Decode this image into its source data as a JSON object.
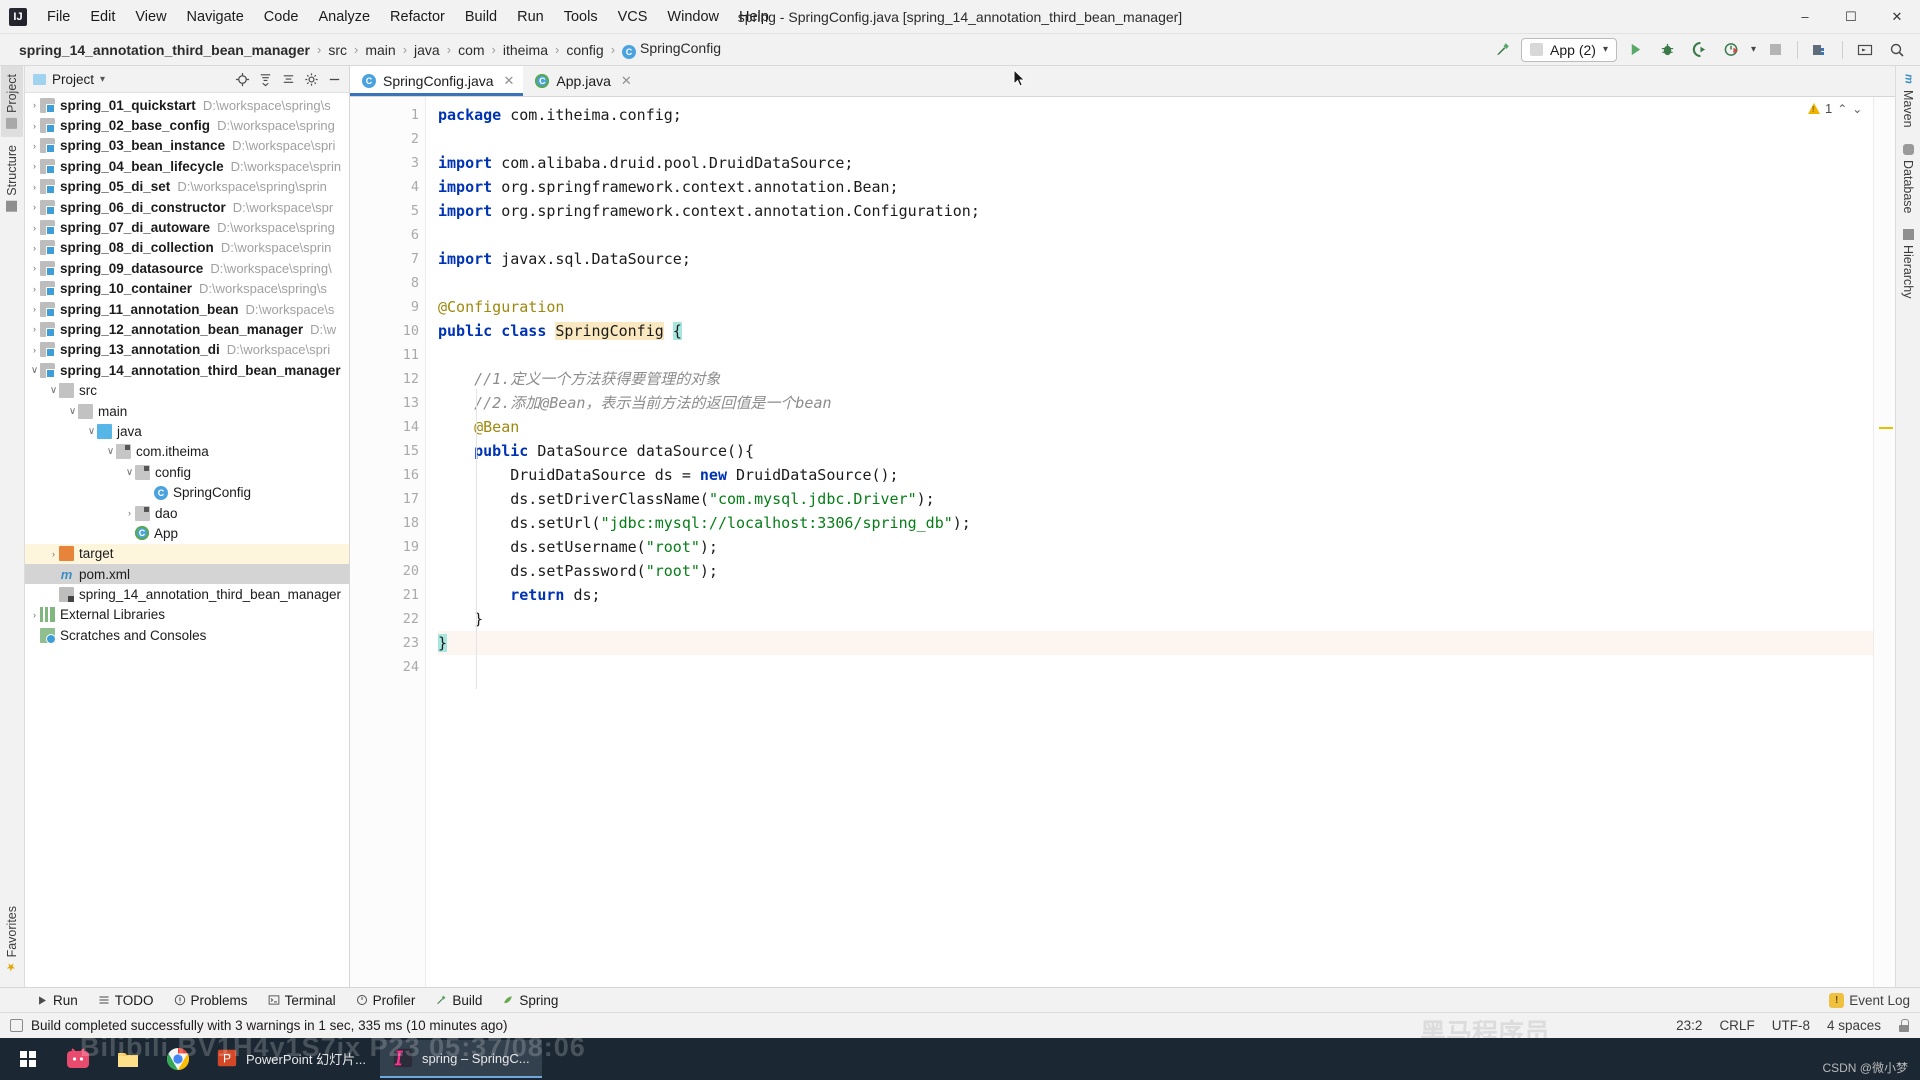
{
  "window": {
    "title": "spring - SpringConfig.java [spring_14_annotation_third_bean_manager]",
    "logo": "intellij-idea-logo",
    "minimize": "–",
    "maximize": "☐",
    "close": "✕"
  },
  "menu": [
    {
      "label": "File"
    },
    {
      "label": "Edit"
    },
    {
      "label": "View"
    },
    {
      "label": "Navigate"
    },
    {
      "label": "Code"
    },
    {
      "label": "Analyze"
    },
    {
      "label": "Refactor"
    },
    {
      "label": "Build"
    },
    {
      "label": "Run"
    },
    {
      "label": "Tools"
    },
    {
      "label": "VCS"
    },
    {
      "label": "Window"
    },
    {
      "label": "Help"
    }
  ],
  "breadcrumb": {
    "root": "spring_14_annotation_third_bean_manager",
    "items": [
      "src",
      "main",
      "java",
      "com",
      "itheima",
      "config"
    ],
    "leaf": "SpringConfig",
    "leaf_icon_letter": "C",
    "separator": "›"
  },
  "toolbar": {
    "build_icon": "hammer-icon",
    "run_config": "App (2)",
    "run_config_caret": "▾",
    "run_icon": "run-play-icon",
    "debug_icon": "debug-bug-icon",
    "run_coverage_icon": "run-with-coverage-icon",
    "profiler_icon": "profiler-icon",
    "profiler_caret": "▾",
    "stop_icon": "stop-icon",
    "updates_icon": "project-structure-icon",
    "layout_icon": "layout-icon",
    "search_icon": "search-everywhere-icon"
  },
  "left_strip": {
    "top": [
      {
        "label": "Project",
        "icon": "project-icon",
        "active": true
      },
      {
        "label": "Structure",
        "icon": "structure-icon",
        "active": false
      }
    ],
    "bottom": [
      {
        "label": "Favorites",
        "icon": "star-icon"
      }
    ]
  },
  "right_strip": {
    "items": [
      {
        "label": "Maven",
        "icon": "maven-icon"
      },
      {
        "label": "Database",
        "icon": "database-icon"
      },
      {
        "label": "Hierarchy",
        "icon": "hierarchy-icon"
      }
    ]
  },
  "project_panel": {
    "title": "Project",
    "title_caret": "▾",
    "actions": [
      {
        "name": "locate-icon",
        "glyph": "⊕"
      },
      {
        "name": "expand-all-icon",
        "glyph": "≣"
      },
      {
        "name": "collapse-all-icon",
        "glyph": "≡"
      },
      {
        "name": "settings-gear-icon",
        "glyph": "⚙"
      },
      {
        "name": "hide-icon",
        "glyph": "—"
      }
    ],
    "tree": [
      {
        "depth": 1,
        "arrow": "›",
        "icon": "module",
        "name": "spring_01_quickstart",
        "bold": true,
        "path": "D:\\workspace\\spring\\s"
      },
      {
        "depth": 1,
        "arrow": "›",
        "icon": "module",
        "name": "spring_02_base_config",
        "bold": true,
        "path": "D:\\workspace\\spring"
      },
      {
        "depth": 1,
        "arrow": "›",
        "icon": "module",
        "name": "spring_03_bean_instance",
        "bold": true,
        "path": "D:\\workspace\\spri"
      },
      {
        "depth": 1,
        "arrow": "›",
        "icon": "module",
        "name": "spring_04_bean_lifecycle",
        "bold": true,
        "path": "D:\\workspace\\sprin"
      },
      {
        "depth": 1,
        "arrow": "›",
        "icon": "module",
        "name": "spring_05_di_set",
        "bold": true,
        "path": "D:\\workspace\\spring\\sprin"
      },
      {
        "depth": 1,
        "arrow": "›",
        "icon": "module",
        "name": "spring_06_di_constructor",
        "bold": true,
        "path": "D:\\workspace\\spr"
      },
      {
        "depth": 1,
        "arrow": "›",
        "icon": "module",
        "name": "spring_07_di_autoware",
        "bold": true,
        "path": "D:\\workspace\\spring"
      },
      {
        "depth": 1,
        "arrow": "›",
        "icon": "module",
        "name": "spring_08_di_collection",
        "bold": true,
        "path": "D:\\workspace\\sprin"
      },
      {
        "depth": 1,
        "arrow": "›",
        "icon": "module",
        "name": "spring_09_datasource",
        "bold": true,
        "path": "D:\\workspace\\spring\\"
      },
      {
        "depth": 1,
        "arrow": "›",
        "icon": "module",
        "name": "spring_10_container",
        "bold": true,
        "path": "D:\\workspace\\spring\\s"
      },
      {
        "depth": 1,
        "arrow": "›",
        "icon": "module",
        "name": "spring_11_annotation_bean",
        "bold": true,
        "path": "D:\\workspace\\s"
      },
      {
        "depth": 1,
        "arrow": "›",
        "icon": "module",
        "name": "spring_12_annotation_bean_manager",
        "bold": true,
        "path": "D:\\w"
      },
      {
        "depth": 1,
        "arrow": "›",
        "icon": "module",
        "name": "spring_13_annotation_di",
        "bold": true,
        "path": "D:\\workspace\\spri"
      },
      {
        "depth": 1,
        "arrow": "⌄",
        "icon": "module",
        "name": "spring_14_annotation_third_bean_manager",
        "bold": true,
        "path": ""
      },
      {
        "depth": 2,
        "arrow": "⌄",
        "icon": "folder",
        "name": "src",
        "bold": false,
        "path": ""
      },
      {
        "depth": 3,
        "arrow": "⌄",
        "icon": "folder",
        "name": "main",
        "bold": false,
        "path": ""
      },
      {
        "depth": 4,
        "arrow": "⌄",
        "icon": "folder-blue",
        "name": "java",
        "bold": false,
        "path": ""
      },
      {
        "depth": 5,
        "arrow": "⌄",
        "icon": "package",
        "name": "com.itheima",
        "bold": false,
        "path": ""
      },
      {
        "depth": 6,
        "arrow": "⌄",
        "icon": "package",
        "name": "config",
        "bold": false,
        "path": ""
      },
      {
        "depth": 7,
        "arrow": "",
        "icon": "class",
        "name": "SpringConfig",
        "bold": false,
        "path": ""
      },
      {
        "depth": 6,
        "arrow": "›",
        "icon": "package",
        "name": "dao",
        "bold": false,
        "path": ""
      },
      {
        "depth": 6,
        "arrow": "",
        "icon": "class-run",
        "name": "App",
        "bold": false,
        "path": ""
      },
      {
        "depth": 2,
        "arrow": "›",
        "icon": "folder-orange",
        "name": "target",
        "bold": false,
        "path": "",
        "highlight": "target"
      },
      {
        "depth": 2,
        "arrow": "",
        "icon": "maven",
        "name": "pom.xml",
        "bold": false,
        "path": "",
        "highlight": "selected"
      },
      {
        "depth": 2,
        "arrow": "",
        "icon": "iml",
        "name": "spring_14_annotation_third_bean_manager",
        "bold": false,
        "path": ""
      },
      {
        "depth": 1,
        "arrow": "›",
        "icon": "library",
        "name": "External Libraries",
        "bold": false,
        "path": ""
      },
      {
        "depth": 1,
        "arrow": "",
        "icon": "scratch",
        "name": "Scratches and Consoles",
        "bold": false,
        "path": ""
      }
    ]
  },
  "editor": {
    "tabs": [
      {
        "label": "SpringConfig.java",
        "icon_letter": "C",
        "active": true,
        "close": "✕"
      },
      {
        "label": "App.java",
        "icon_letter": "C",
        "active": false,
        "close": "✕"
      }
    ],
    "warning_count": "1",
    "warning_icon": "warning-triangle-icon",
    "chevron_up": "⌃",
    "chevron_down": "⌄",
    "lines": [
      {
        "n": 1,
        "fold": "",
        "mark": "",
        "text": "package com.itheima.config;"
      },
      {
        "n": 2,
        "fold": "",
        "mark": "",
        "text": ""
      },
      {
        "n": 3,
        "fold": "minus",
        "mark": "",
        "text": "import com.alibaba.druid.pool.DruidDataSource;"
      },
      {
        "n": 4,
        "fold": "",
        "mark": "",
        "text": "import org.springframework.context.annotation.Bean;"
      },
      {
        "n": 5,
        "fold": "",
        "mark": "",
        "text": "import org.springframework.context.annotation.Configuration;"
      },
      {
        "n": 6,
        "fold": "",
        "mark": "",
        "text": ""
      },
      {
        "n": 7,
        "fold": "minus",
        "mark": "",
        "text": "import javax.sql.DataSource;"
      },
      {
        "n": 8,
        "fold": "",
        "mark": "",
        "text": ""
      },
      {
        "n": 9,
        "fold": "",
        "mark": "",
        "text": "@Configuration"
      },
      {
        "n": 10,
        "fold": "",
        "mark": "spring-bean-icon",
        "text": "public class SpringConfig {"
      },
      {
        "n": 11,
        "fold": "",
        "mark": "",
        "text": ""
      },
      {
        "n": 12,
        "fold": "minus",
        "mark": "",
        "text": "    //1.定义一个方法获得要管理的对象"
      },
      {
        "n": 13,
        "fold": "minus",
        "mark": "",
        "text": "    //2.添加@Bean，表示当前方法的返回值是一个bean"
      },
      {
        "n": 14,
        "fold": "",
        "mark": "spring-bean-icon",
        "text": "    @Bean"
      },
      {
        "n": 15,
        "fold": "minus",
        "mark": "",
        "text": "    public DataSource dataSource(){"
      },
      {
        "n": 16,
        "fold": "",
        "mark": "",
        "text": "        DruidDataSource ds = new DruidDataSource();"
      },
      {
        "n": 17,
        "fold": "",
        "mark": "",
        "text": "        ds.setDriverClassName(\"com.mysql.jdbc.Driver\");"
      },
      {
        "n": 18,
        "fold": "",
        "mark": "",
        "text": "        ds.setUrl(\"jdbc:mysql://localhost:3306/spring_db\");"
      },
      {
        "n": 19,
        "fold": "",
        "mark": "",
        "text": "        ds.setUsername(\"root\");"
      },
      {
        "n": 20,
        "fold": "",
        "mark": "",
        "text": "        ds.setPassword(\"root\");"
      },
      {
        "n": 21,
        "fold": "",
        "mark": "",
        "text": "        return ds;"
      },
      {
        "n": 22,
        "fold": "minus",
        "mark": "",
        "text": "    }"
      },
      {
        "n": 23,
        "fold": "",
        "mark": "",
        "text": "}"
      },
      {
        "n": 24,
        "fold": "",
        "mark": "",
        "text": ""
      }
    ]
  },
  "bottom_bar": {
    "items": [
      {
        "label": "Run",
        "icon": "run-play-icon"
      },
      {
        "label": "TODO",
        "icon": "todo-list-icon"
      },
      {
        "label": "Problems",
        "icon": "problems-icon"
      },
      {
        "label": "Terminal",
        "icon": "terminal-icon"
      },
      {
        "label": "Profiler",
        "icon": "profiler-icon"
      },
      {
        "label": "Build",
        "icon": "hammer-icon"
      },
      {
        "label": "Spring",
        "icon": "spring-leaf-icon"
      }
    ],
    "event_log": "Event Log",
    "event_log_icon": "event-log-icon"
  },
  "status_bar": {
    "message": "Build completed successfully with 3 warnings in 1 sec, 335 ms (10 minutes ago)",
    "message_icon": "build-status-icon",
    "caret_position": "23:2",
    "line_separator": "CRLF",
    "encoding": "UTF-8",
    "indent": "4 spaces",
    "lock_icon": "read-only-lock-icon"
  },
  "taskbar": {
    "start_icon": "windows-start-icon",
    "pinned": [
      {
        "name": "bilibili-icon"
      },
      {
        "name": "file-explorer-icon"
      },
      {
        "name": "chrome-icon"
      }
    ],
    "apps": [
      {
        "label": "PowerPoint 幻灯片...",
        "icon": "powerpoint-icon",
        "active": false
      },
      {
        "label": "spring – SpringC...",
        "icon": "intellij-idea-icon",
        "active": true
      }
    ],
    "watermark": "Bilibili BV1H4y1S7ix P23 05:37/08:06",
    "csdn": "CSDN @微小梦"
  },
  "watermark_center": "黑马程序员"
}
